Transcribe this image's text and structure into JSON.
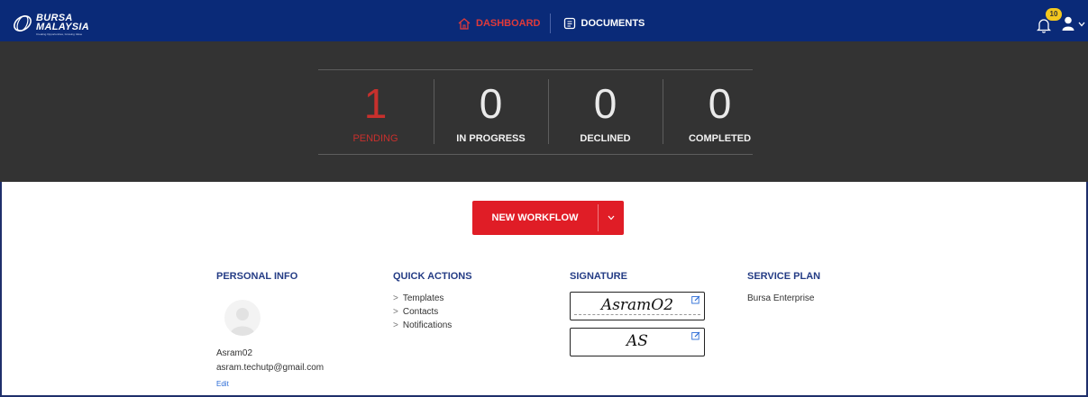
{
  "brand": {
    "line1": "BURSA",
    "line2": "MALAYSIA",
    "tagline": "Creating Opportunities, Growing Value"
  },
  "nav": {
    "dashboard": "DASHBOARD",
    "documents": "DOCUMENTS"
  },
  "notifications": {
    "count": "10"
  },
  "stats": [
    {
      "value": "1",
      "label": "PENDING"
    },
    {
      "value": "0",
      "label": "IN PROGRESS"
    },
    {
      "value": "0",
      "label": "DECLINED"
    },
    {
      "value": "0",
      "label": "COMPLETED"
    }
  ],
  "workflow_button": {
    "label": "NEW WORKFLOW"
  },
  "personal_info": {
    "title": "PERSONAL INFO",
    "username": "Asram02",
    "email": "asram.techutp@gmail.com",
    "edit_label": "Edit"
  },
  "quick_actions": {
    "title": "QUICK ACTIONS",
    "items": [
      "Templates",
      "Contacts",
      "Notifications"
    ]
  },
  "signature": {
    "title": "SIGNATURE",
    "full": "AsramO2",
    "initials": "AS"
  },
  "service_plan": {
    "title": "SERVICE PLAN",
    "plan": "Bursa Enterprise"
  },
  "colors": {
    "header": "#0a2a78",
    "band": "#333333",
    "accent_red": "#e01d26",
    "title_blue": "#243c85",
    "badge": "#f3c81e"
  }
}
